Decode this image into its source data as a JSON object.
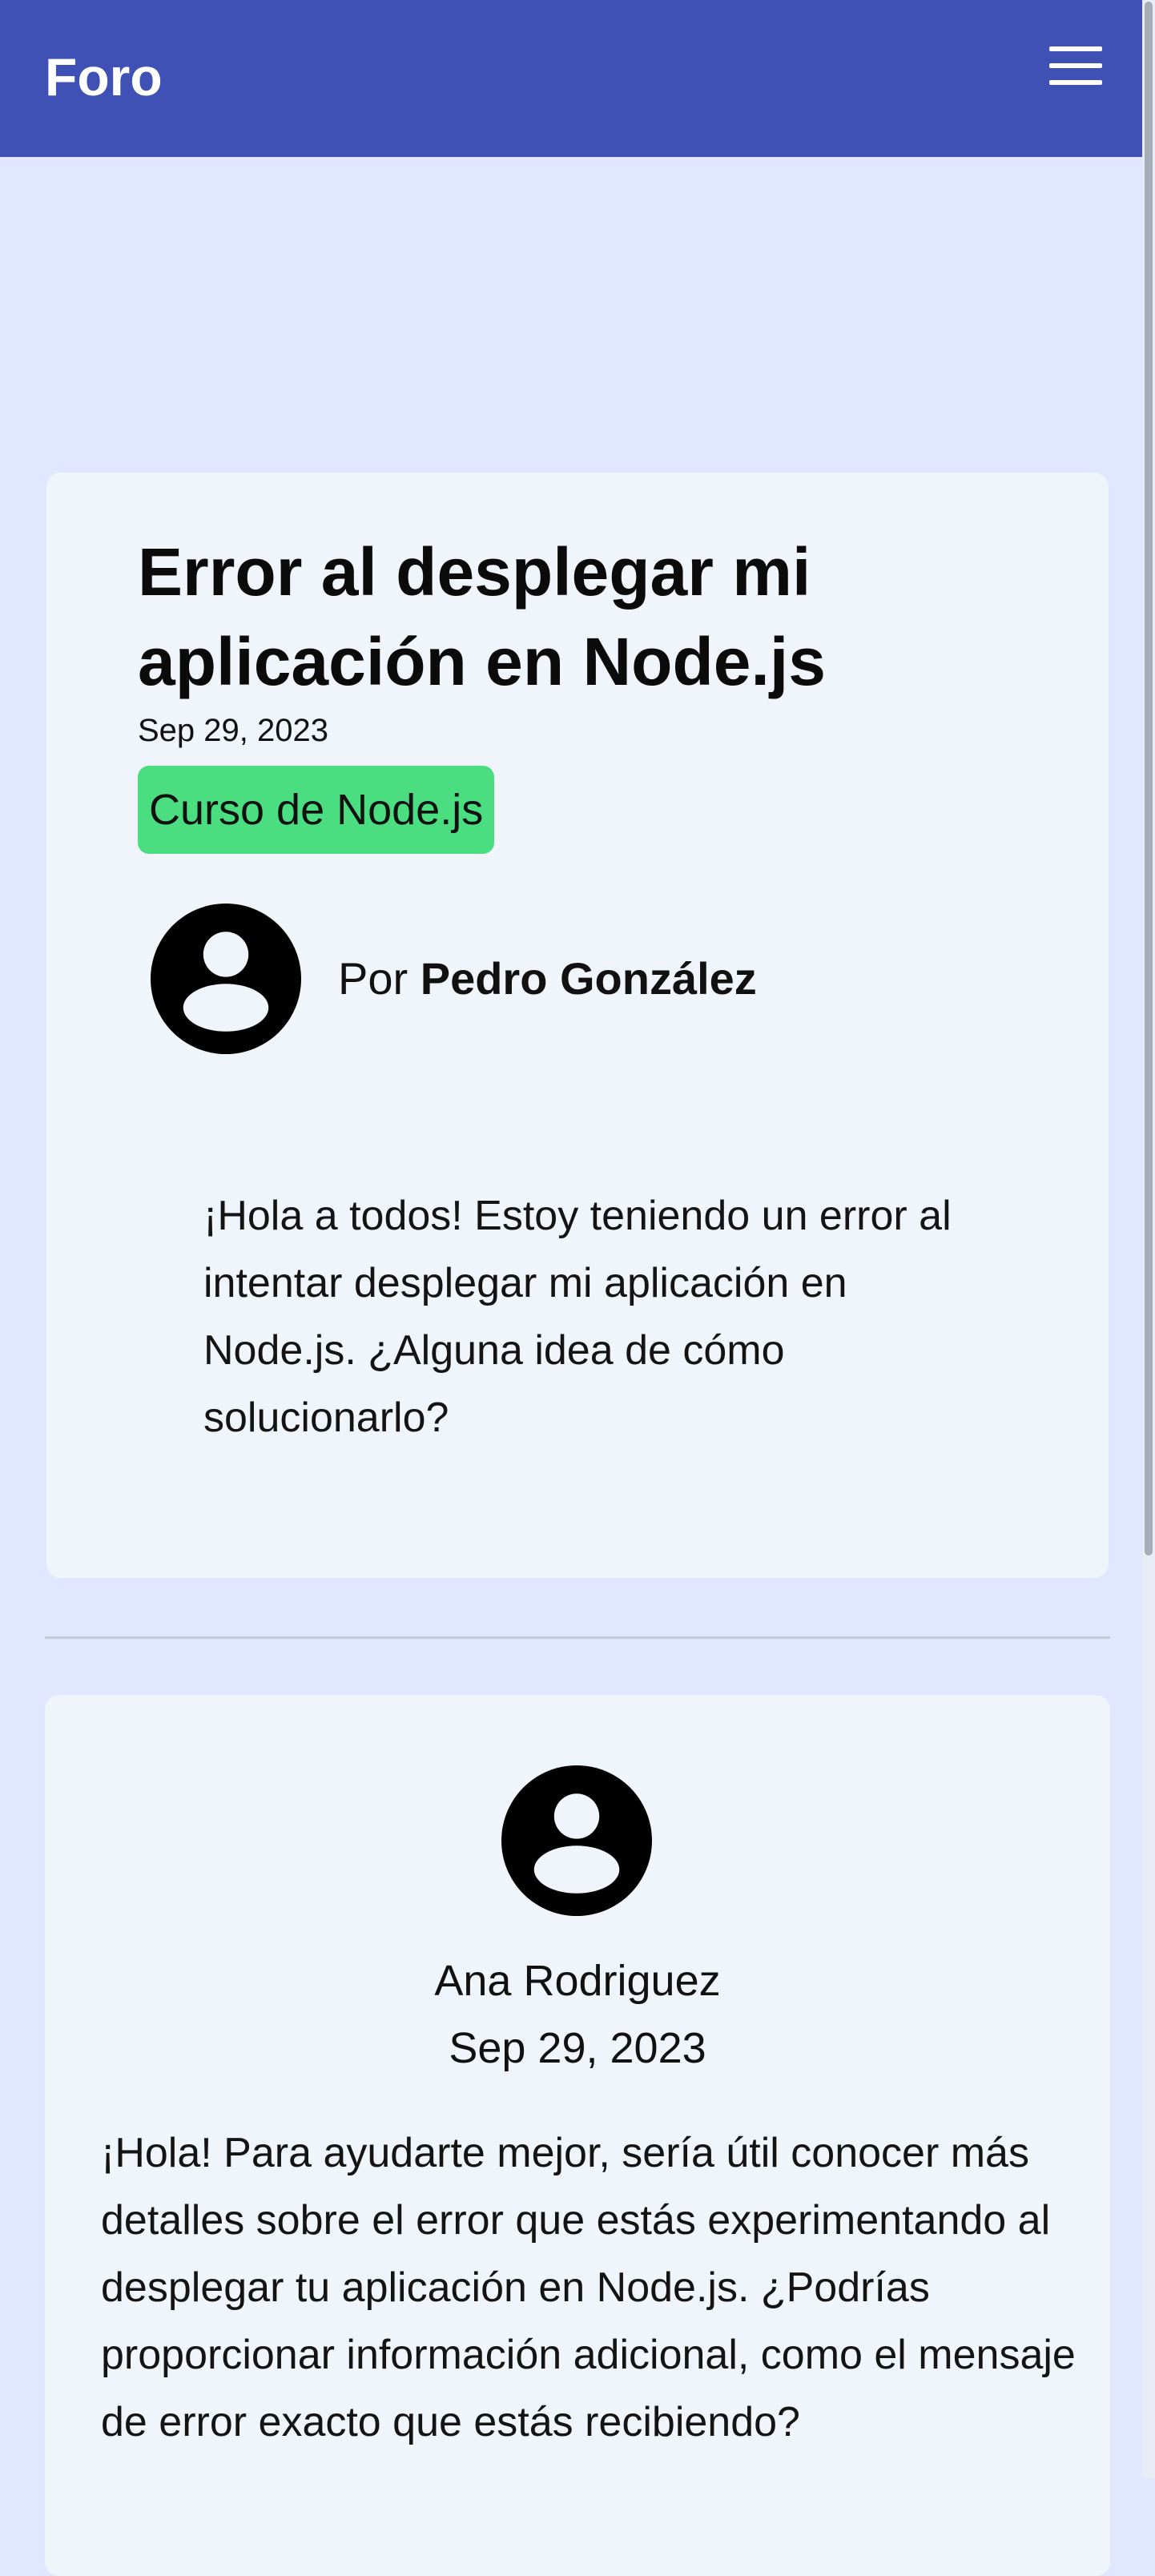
{
  "navbar": {
    "brand": "Foro",
    "menu_icon": "hamburger-menu-icon"
  },
  "post": {
    "title": "Error al desplegar mi aplicación en Node.js",
    "date": "Sep 29, 2023",
    "course": "Curso de Node.js",
    "author_prefix": "Por",
    "author": "Pedro González",
    "avatar_icon": "account-circle-icon",
    "body": "¡Hola a todos! Estoy teniendo un error al intentar desplegar mi aplicación en Node.js. ¿Alguna idea de cómo solucionarlo?"
  },
  "reply": {
    "author": "Ana Rodriguez",
    "date": "Sep 29, 2023",
    "avatar_icon": "account-circle-icon",
    "body": "¡Hola! Para ayudarte mejor, sería útil conocer más detalles sobre el error que estás experimentando al desplegar tu aplicación en Node.js. ¿Podrías proporcionar información adicional, como el mensaje de error exacto que estás recibiendo?"
  },
  "colors": {
    "navbar": "#3f51b5",
    "page_background": "#e0e7ff",
    "card_background": "#f0f4fb",
    "course_badge": "#4ade80"
  }
}
